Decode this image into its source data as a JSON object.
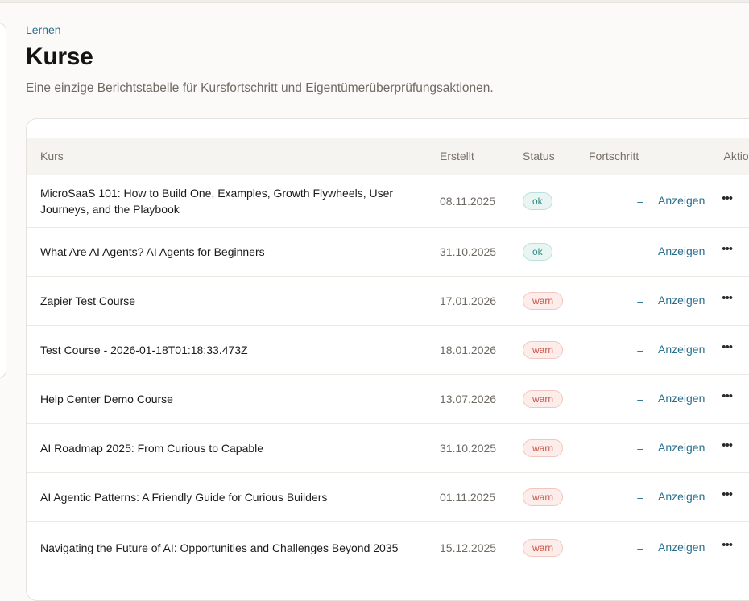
{
  "breadcrumb": "Lernen",
  "title": "Kurse",
  "subtitle": "Eine einzige Berichtstabelle für Kursfortschritt und Eigentümerüberprüfungsaktionen.",
  "table": {
    "headers": {
      "course": "Kurs",
      "created": "Erstellt",
      "status": "Status",
      "progress": "Fortschritt",
      "actions": "Aktionen"
    },
    "rows": [
      {
        "name": "MicroSaaS 101: How to Build One, Examples, Growth Flywheels, User Journeys, and the Playbook",
        "created": "08.11.2025",
        "status": "ok",
        "progress": "–",
        "action": "Anzeigen"
      },
      {
        "name": "What Are AI Agents? AI Agents for Beginners",
        "created": "31.10.2025",
        "status": "ok",
        "progress": "–",
        "action": "Anzeigen"
      },
      {
        "name": "Zapier Test Course",
        "created": "17.01.2026",
        "status": "warn",
        "progress": "–",
        "action": "Anzeigen"
      },
      {
        "name": "Test Course - 2026-01-18T01:18:33.473Z",
        "created": "18.01.2026",
        "status": "warn",
        "progress": "–",
        "action": "Anzeigen"
      },
      {
        "name": "Help Center Demo Course",
        "created": "13.07.2026",
        "status": "warn",
        "progress": "–",
        "action": "Anzeigen"
      },
      {
        "name": "AI Roadmap 2025: From Curious to Capable",
        "created": "31.10.2025",
        "status": "warn",
        "progress": "–",
        "action": "Anzeigen"
      },
      {
        "name": "AI Agentic Patterns: A Friendly Guide for Curious Builders",
        "created": "01.11.2025",
        "status": "warn",
        "progress": "–",
        "action": "Anzeigen"
      },
      {
        "name": "Navigating the Future of AI: Opportunities and Challenges Beyond 2035",
        "created": "15.12.2025",
        "status": "warn",
        "progress": "–",
        "action": "Anzeigen"
      }
    ]
  }
}
